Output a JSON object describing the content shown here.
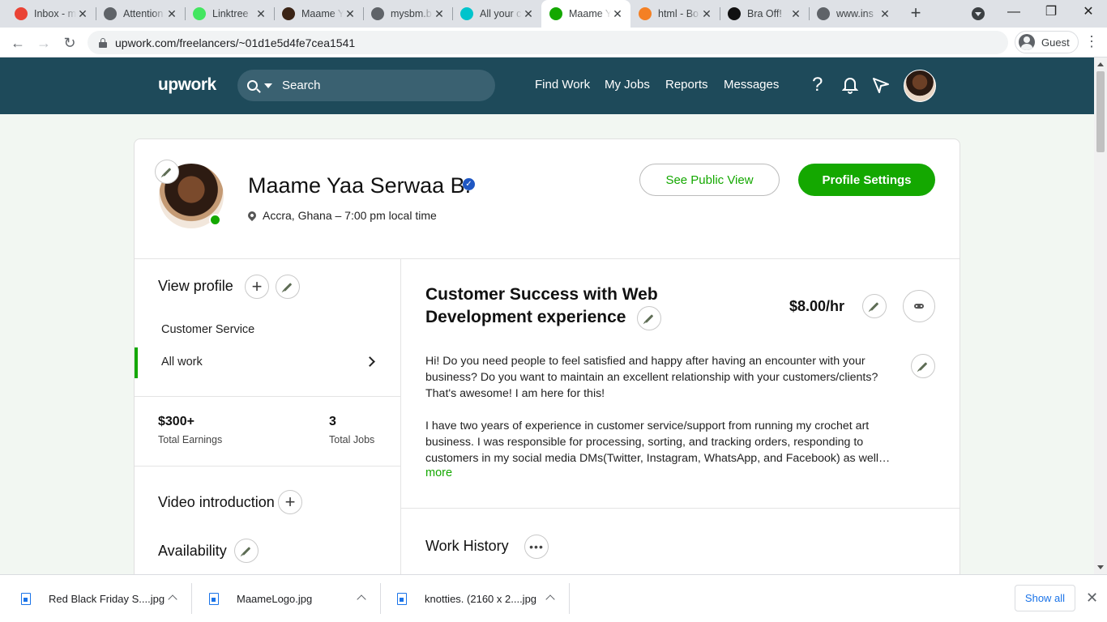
{
  "browser": {
    "tabs": [
      {
        "title": "Inbox - m",
        "favicon": "gmail-icon",
        "color": "#ea4335"
      },
      {
        "title": "Attention",
        "favicon": "globe-icon",
        "color": "#5f6368"
      },
      {
        "title": "Linktree",
        "favicon": "linktree-icon",
        "color": "#43e660"
      },
      {
        "title": "Maame Y",
        "favicon": "avatar-icon",
        "color": "#3b2416"
      },
      {
        "title": "mysbm.b",
        "favicon": "globe-icon",
        "color": "#5f6368"
      },
      {
        "title": "All your c",
        "favicon": "canva-icon",
        "color": "#00c4cc"
      },
      {
        "title": "Maame Y",
        "favicon": "upwork-icon",
        "color": "#14a800"
      },
      {
        "title": "html - Bo",
        "favicon": "stackoverflow-icon",
        "color": "#f48024"
      },
      {
        "title": "Bra Off!",
        "favicon": "braoff-icon",
        "color": "#111111"
      },
      {
        "title": "www.ins",
        "favicon": "globe-icon",
        "color": "#5f6368"
      }
    ],
    "url": "upwork.com/freelancers/~01d1e5d4fe7cea1541",
    "profile_label": "Guest"
  },
  "header": {
    "logo": "upwork",
    "search_placeholder": "Search",
    "nav": [
      "Find Work",
      "My Jobs",
      "Reports",
      "Messages"
    ]
  },
  "profile": {
    "name": "Maame Yaa Serwaa B.",
    "location": "Accra, Ghana – 7:00 pm local time",
    "see_public_view": "See Public View",
    "profile_settings": "Profile Settings"
  },
  "sidebar": {
    "view_profile_title": "View profile",
    "specialized": [
      {
        "label": "Customer Service"
      },
      {
        "label": "All work"
      }
    ],
    "stats": [
      {
        "value": "$300+",
        "label": "Total Earnings"
      },
      {
        "value": "3",
        "label": "Total Jobs"
      }
    ],
    "video_intro_title": "Video introduction",
    "availability_title": "Availability"
  },
  "main": {
    "job_title": "Customer Success with Web Development experience",
    "rate": "$8.00/hr",
    "overview": [
      "Hi! Do you need people to feel satisfied and happy after having an encounter with your business? Do you want to maintain an excellent relationship with your customers/clients? That's awesome! I am here for this!",
      "I have two years of experience in customer service/support from running my crochet art business. I was responsible for processing, sorting, and tracking orders, responding to customers in my social media DMs(Twitter, Instagram, WhatsApp, and Facebook) as well…"
    ],
    "more_label": "more",
    "work_history_title": "Work History"
  },
  "downloads": {
    "items": [
      {
        "name": "Red Black Friday S....jpg"
      },
      {
        "name": "MaameLogo.jpg"
      },
      {
        "name": "knotties. (2160 x 2....jpg"
      }
    ],
    "show_all": "Show all"
  },
  "colors": {
    "upwork_green": "#14a800",
    "header_bg": "#1e4a5a"
  }
}
